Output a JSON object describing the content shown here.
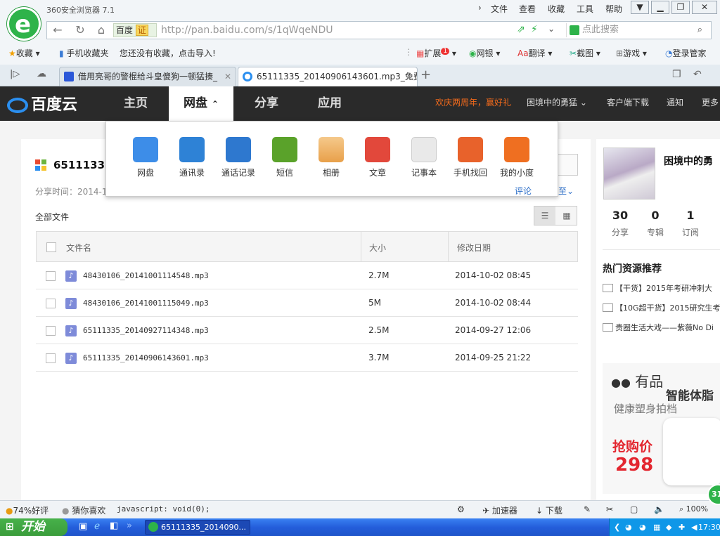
{
  "browser": {
    "title": "360安全浏览器 7.1",
    "menus": [
      "文件",
      "查看",
      "收藏",
      "工具",
      "帮助"
    ],
    "address": {
      "engine": "百度",
      "cert": "证",
      "url_host": "http://pan.baidu.com",
      "url_path": "/s/1qWqeNDU"
    },
    "search_placeholder": "点此搜索",
    "favbar": {
      "fav_label": "收藏",
      "mobile_fav": "手机收藏夹",
      "import_hint": "您还没有收藏，点击导入!",
      "extensions": "扩展",
      "ext_badge": "1",
      "bank": "网银",
      "translate": "翻译",
      "screenshot": "截图",
      "games": "游戏",
      "manager": "登录管家"
    },
    "tabs": [
      {
        "label": "借用亮哥的警棍给斗皇傻狗一顿猛揍_"
      },
      {
        "label": "65111335_20140906143601.mp3_免费高"
      }
    ],
    "new_tab": "+"
  },
  "baidu": {
    "logo": "百度云",
    "nav": [
      "主页",
      "网盘",
      "分享",
      "应用"
    ],
    "promo": "欢庆两周年，赢好礼",
    "user_menu": "困境中的勇猛",
    "client_download": "客户端下载",
    "notice": "通知",
    "more": "更多"
  },
  "dropdown": {
    "apps": [
      {
        "label": "网盘",
        "color": "#3d8de8"
      },
      {
        "label": "通讯录",
        "color": "#2e82d6"
      },
      {
        "label": "通话记录",
        "color": "#2e78cf"
      },
      {
        "label": "短信",
        "color": "#5aa22a"
      },
      {
        "label": "相册",
        "color": "#e8a04a"
      },
      {
        "label": "文章",
        "color": "#e2483b"
      },
      {
        "label": "记事本",
        "color": "#e9e9e9"
      },
      {
        "label": "手机找回",
        "color": "#e8622b"
      },
      {
        "label": "我的小度",
        "color": "#ef6f21"
      }
    ],
    "comment": "评论"
  },
  "share": {
    "title": "65111335_",
    "share_time_label": "分享时间：2014-1",
    "more_link": "至",
    "all_files": "全部文件",
    "headers": {
      "name": "文件名",
      "size": "大小",
      "date": "修改日期"
    },
    "files": [
      {
        "name": "48430106_20141001114548.mp3",
        "size": "2.7M",
        "date": "2014-10-02 08:45"
      },
      {
        "name": "48430106_20141001115049.mp3",
        "size": "5M",
        "date": "2014-10-02 08:44"
      },
      {
        "name": "65111335_20140927114348.mp3",
        "size": "2.5M",
        "date": "2014-09-27 12:06"
      },
      {
        "name": "65111335_20140906143601.mp3",
        "size": "3.7M",
        "date": "2014-09-25 21:22"
      }
    ]
  },
  "profile": {
    "name": "困境中的勇",
    "stats": [
      {
        "value": "30",
        "label": "分享"
      },
      {
        "value": "0",
        "label": "专辑"
      },
      {
        "value": "1",
        "label": "订阅"
      }
    ],
    "hot_title": "热门资源推荐",
    "hot": [
      "【干货】2015年考研冲刺大",
      "【10G超干货】2015研究生考",
      "贵圈生活大戏——紫薇No Di"
    ],
    "ad": {
      "brand": "有品",
      "product": "智能体脂",
      "slogan": "健康塑身拍档",
      "price_label": "抢购价",
      "price": "298"
    }
  },
  "statusbar": {
    "rating": "74%好评",
    "guess": "猜你喜欢",
    "status_text": "javascript: void(0);",
    "accelerator": "加速器",
    "download": "下载",
    "zoom": "100%",
    "badge": "31"
  },
  "taskbar": {
    "start": "开始",
    "task": "65111335_2014090...",
    "clock": "17:30"
  }
}
